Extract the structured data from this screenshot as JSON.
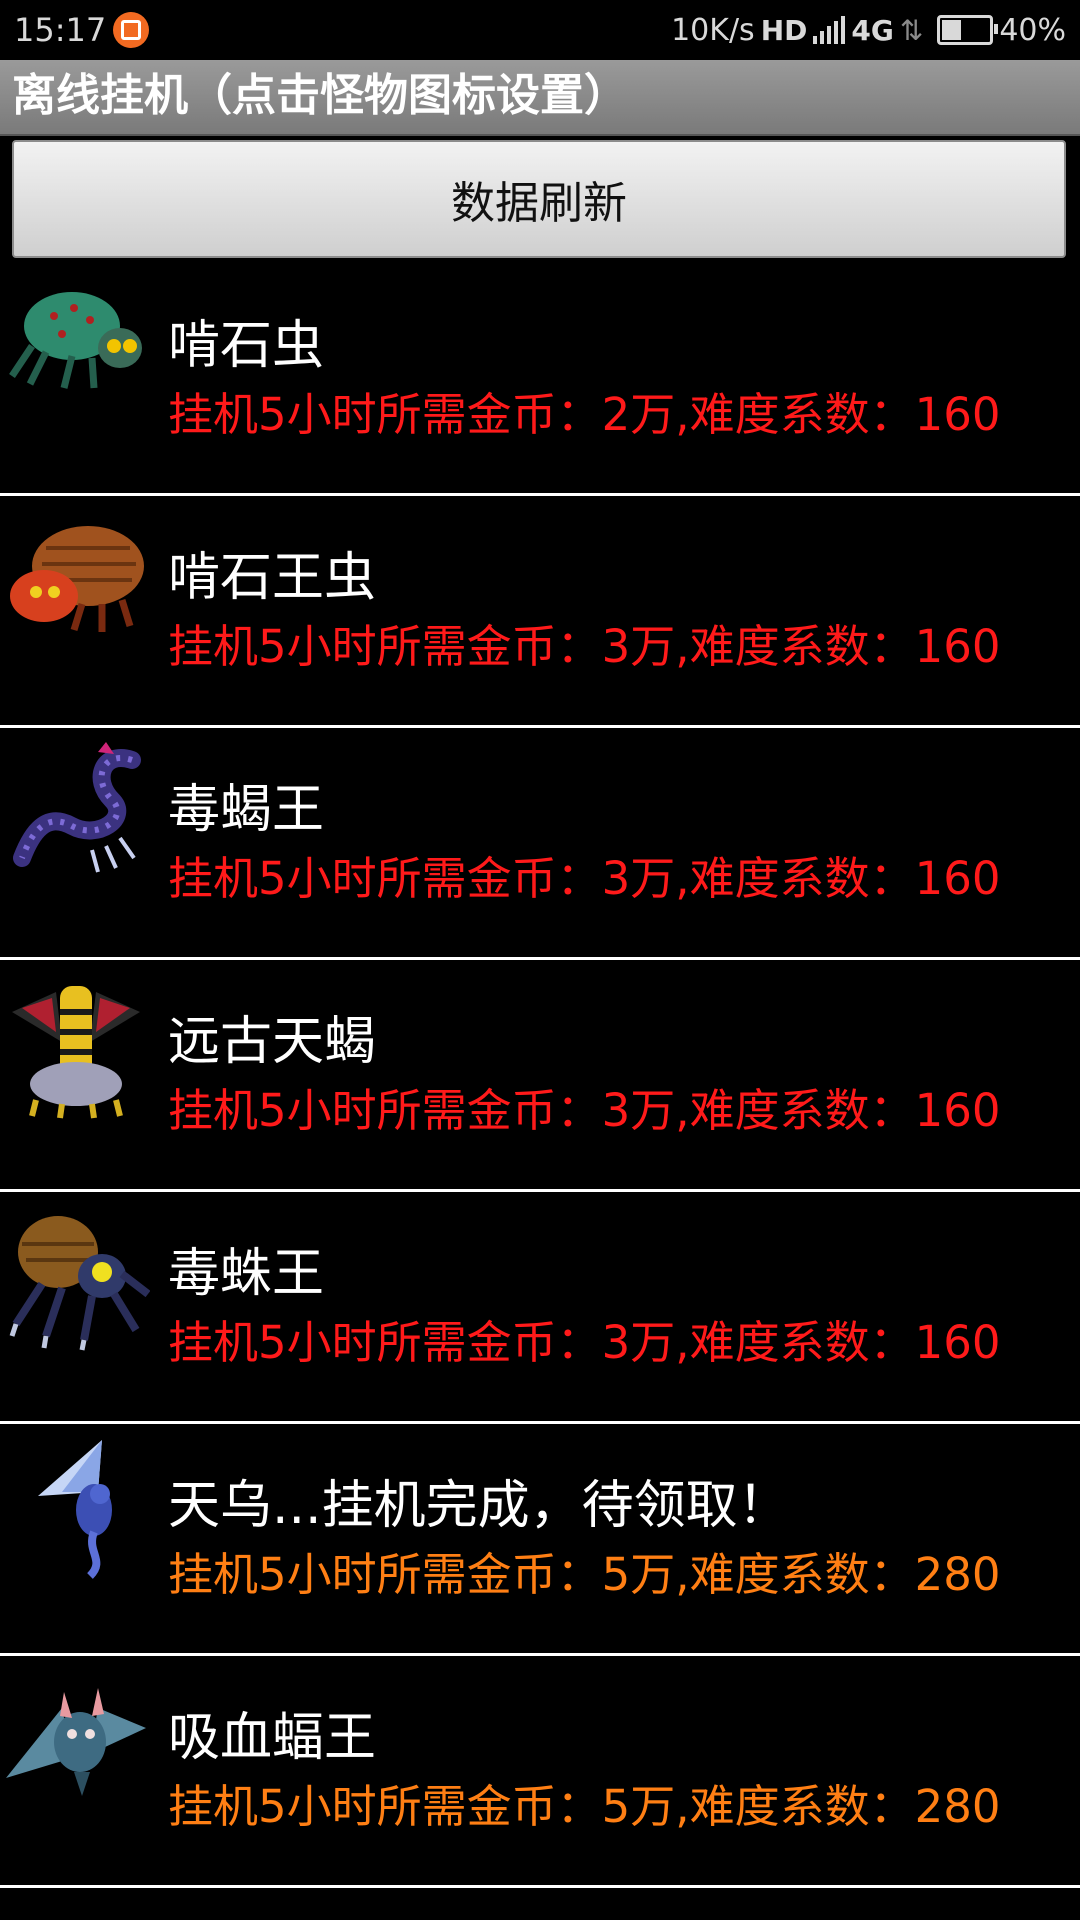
{
  "status_bar": {
    "time": "15:17",
    "net_speed": "10K/s",
    "hd": "HD",
    "network": "4G",
    "battery_level": 0.4,
    "battery_text": "40%"
  },
  "header": {
    "title": "离线挂机（点击怪物图标设置）"
  },
  "refresh_button": {
    "label": "数据刷新"
  },
  "monsters": [
    {
      "name": "啃石虫",
      "info": "挂机5小时所需金币：2万,难度系数：160",
      "info_color": "#ff1a1a",
      "icon": "green-spider-monster-icon"
    },
    {
      "name": "啃石王虫",
      "info": "挂机5小时所需金币：3万,难度系数：160",
      "info_color": "#ff1a1a",
      "icon": "orange-beetle-monster-icon"
    },
    {
      "name": "毒蝎王",
      "info": "挂机5小时所需金币：3万,难度系数：160",
      "info_color": "#ff1a1a",
      "icon": "purple-serpent-monster-icon"
    },
    {
      "name": "远古天蝎",
      "info": "挂机5小时所需金币：3万,难度系数：160",
      "info_color": "#ff1a1a",
      "icon": "gold-dragon-monster-icon"
    },
    {
      "name": "毒蛛王",
      "info": "挂机5小时所需金币：3万,难度系数：160",
      "info_color": "#ff1a1a",
      "icon": "spider-king-monster-icon"
    },
    {
      "name": "天乌...挂机完成，待领取！",
      "info": "挂机5小时所需金币：5万,难度系数：280",
      "info_color": "#ff7f14",
      "icon": "blue-bird-monster-icon"
    },
    {
      "name": "吸血蝠王",
      "info": "挂机5小时所需金币：5万,难度系数：280",
      "info_color": "#ff7f14",
      "icon": "vampire-bat-monster-icon"
    }
  ]
}
